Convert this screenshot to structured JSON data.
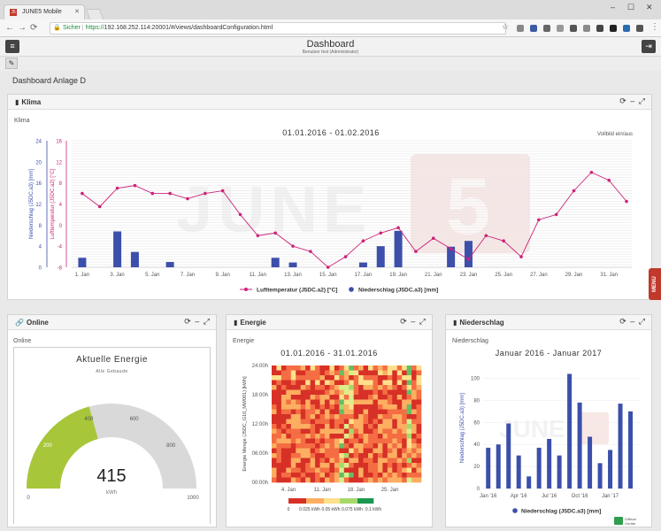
{
  "browser": {
    "tab_title": "JUNE5 Mobile",
    "tab_favicon": "J5",
    "secure_label": "Sicher",
    "url_scheme": "https://",
    "url_rest": "192.168.252.114:20001/#/views/dashboardConfiguration.html"
  },
  "app": {
    "title": "Dashboard",
    "subtitle": "Benutzer test (Administrator)",
    "page_title": "Dashboard Anlage D",
    "menu_tab": "MENU",
    "footer_badge": "Diffison Geräte"
  },
  "panels": {
    "klima": {
      "title": "Klima",
      "icon": "bar-chart-icon",
      "label": "Klima"
    },
    "online": {
      "title": "Online",
      "icon": "link-icon",
      "label": "Online"
    },
    "energie": {
      "title": "Energie",
      "icon": "bar-chart-icon",
      "label": "Energie"
    },
    "niederschlag": {
      "title": "Niederschlag",
      "icon": "bar-chart-icon",
      "label": "Niederschlag"
    }
  },
  "icons": {
    "refresh": "⟳",
    "minimize": "–",
    "expand": "⤢"
  },
  "watermark": "JUNE5",
  "colors": {
    "accent": "#c0392b",
    "temp_line": "#cc2277",
    "precip_bar": "#3c4faa",
    "gauge_fill": "#a8c63a",
    "gauge_rest": "#d9d9d9"
  },
  "chart_data": [
    {
      "type": "line",
      "title": "01.01.2016 - 01.02.2016",
      "fullscreen_toggle": "Vollbild ein/aus",
      "x_ticks": [
        "1. Jan",
        "3. Jan",
        "5. Jan",
        "7. Jan",
        "9. Jan",
        "11. Jan",
        "13. Jan",
        "15. Jan",
        "17. Jan",
        "19. Jan",
        "21. Jan",
        "23. Jan",
        "25. Jan",
        "27. Jan",
        "29. Jan",
        "31. Jan"
      ],
      "y_left_label": "Niederschlag (J5DC.a3) [mm]",
      "y_left_ticks": [
        0,
        4,
        8,
        12,
        16,
        20,
        24
      ],
      "y_right_label": "Lufttemperatur (J5DC.a2) [°C]",
      "y_right_ticks": [
        -8,
        -4,
        0,
        4,
        8,
        12,
        16
      ],
      "y_right_range": [
        -8,
        16
      ],
      "y_left_range": [
        0,
        24
      ],
      "series": [
        {
          "name": "Lufttemperatur (J5DC.a2) [°C]",
          "values": [
            [
              1,
              6.0
            ],
            [
              2,
              3.5
            ],
            [
              3,
              7.0
            ],
            [
              4,
              7.5
            ],
            [
              5,
              6.0
            ],
            [
              6,
              6.0
            ],
            [
              7,
              5.0
            ],
            [
              8,
              6.0
            ],
            [
              9,
              6.5
            ],
            [
              10,
              2.0
            ],
            [
              11,
              -2.0
            ],
            [
              12,
              -1.5
            ],
            [
              13,
              -4.0
            ],
            [
              14,
              -5.0
            ],
            [
              15,
              -8.0
            ],
            [
              16,
              -6.0
            ],
            [
              17,
              -3.0
            ],
            [
              18,
              -1.5
            ],
            [
              19,
              -0.5
            ],
            [
              20,
              -5.0
            ],
            [
              21,
              -2.5
            ],
            [
              22,
              -4.5
            ],
            [
              23,
              -6.5
            ],
            [
              24,
              -2.0
            ],
            [
              25,
              -3.0
            ],
            [
              26,
              -6.0
            ],
            [
              27,
              1.0
            ],
            [
              28,
              2.0
            ],
            [
              29,
              6.5
            ],
            [
              30,
              10.0
            ],
            [
              31,
              8.5
            ],
            [
              32,
              4.5
            ]
          ]
        },
        {
          "name": "Niederschlag (J5DC.a3) [mm]",
          "values": [
            [
              1,
              1.8
            ],
            [
              3,
              6.8
            ],
            [
              4,
              2.9
            ],
            [
              6,
              1.0
            ],
            [
              12,
              1.8
            ],
            [
              13,
              0.9
            ],
            [
              17,
              0.9
            ],
            [
              18,
              4.0
            ],
            [
              19,
              6.9
            ],
            [
              22,
              3.9
            ],
            [
              23,
              5.0
            ]
          ]
        }
      ]
    },
    {
      "type": "gauge",
      "title": "Aktuelle Energie",
      "subtitle": "Alle Gebaude",
      "value": 415,
      "unit": "kWh",
      "min": 0,
      "max": 1000,
      "ticks": [
        0,
        200,
        400,
        600,
        800,
        1000
      ]
    },
    {
      "type": "heatmap",
      "title": "01.01.2016 - 31.01.2016",
      "y_label": "Energie Menge (J5DC_G10_MW001) [kWh]",
      "y_ticks": [
        "00:00h",
        "06:00h",
        "12:00h",
        "18:00h",
        "24:00h"
      ],
      "x_ticks": [
        "4. Jan",
        "11. Jan",
        "18. Jan",
        "25. Jan"
      ],
      "color_scale": [
        "0",
        "0.025 kWh",
        "0.05 kWh",
        "0.075 kWh",
        "0.1 kWh"
      ],
      "days": 31,
      "hours": 24
    },
    {
      "type": "bar",
      "title": "Januar 2016 - Januar 2017",
      "y_label": "Niederschlag (J5DC.a3) [mm]",
      "y_ticks": [
        0,
        20,
        40,
        60,
        80,
        100
      ],
      "y_range": [
        0,
        110
      ],
      "x_ticks": [
        "Jan '16",
        "Apr '16",
        "Jul '16",
        "Oct '16",
        "Jan '17"
      ],
      "series": [
        {
          "name": "Niederschlag (J5DC.a3) [mm]",
          "values": [
            37,
            40,
            59,
            30,
            11,
            37,
            45,
            30,
            104,
            78,
            47,
            23,
            35,
            77,
            70
          ]
        }
      ]
    }
  ]
}
